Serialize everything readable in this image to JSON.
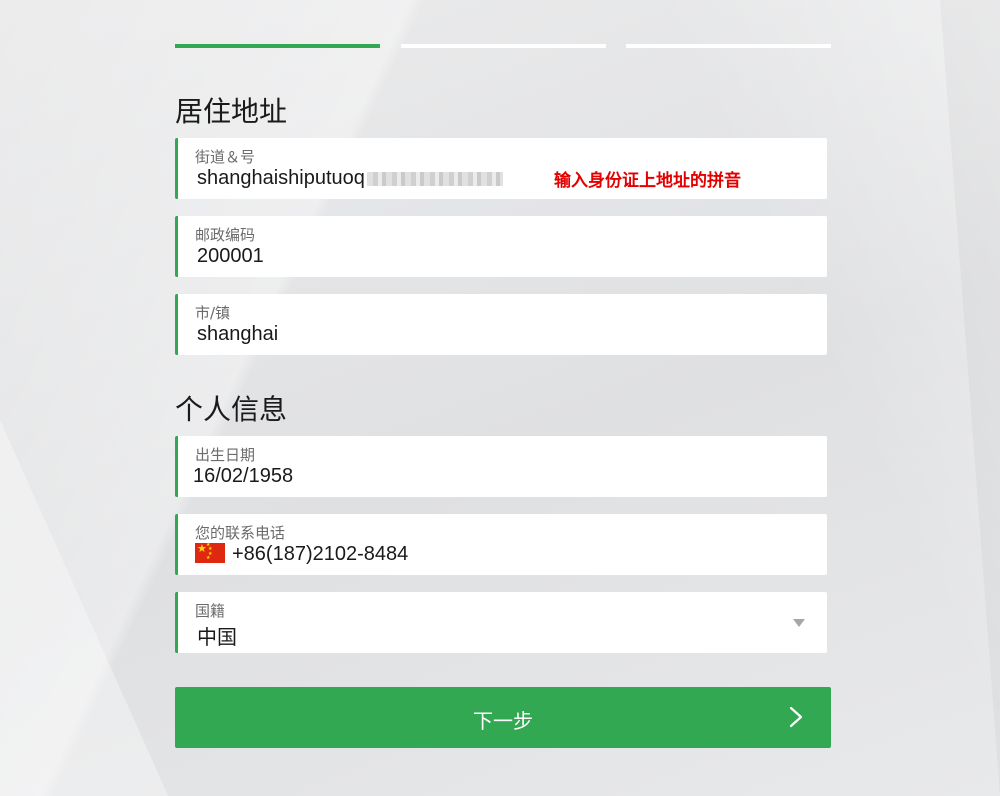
{
  "progress": {
    "total_steps": 3,
    "current_step": 1
  },
  "address_section": {
    "title": "居住地址",
    "street": {
      "label": "街道＆号",
      "value": "shanghaishiputuoq",
      "hint": "输入身份证上地址的拼音"
    },
    "postal_code": {
      "label": "邮政编码",
      "value": "200001"
    },
    "city": {
      "label": "市/镇",
      "value": "shanghai"
    }
  },
  "personal_section": {
    "title": "个人信息",
    "birth_date": {
      "label": "出生日期",
      "value": "16/02/1958"
    },
    "phone": {
      "label": "您的联系电话",
      "value": "+86(187)2102-8484",
      "flag_icon": "china-flag-icon"
    },
    "nationality": {
      "label": "国籍",
      "value": "中国"
    }
  },
  "next_button": {
    "label": "下一步",
    "icon": "chevron-right-icon"
  },
  "colors": {
    "accent_green": "#33a852",
    "hint_red": "#e30000",
    "background": "#e6e7e8"
  }
}
